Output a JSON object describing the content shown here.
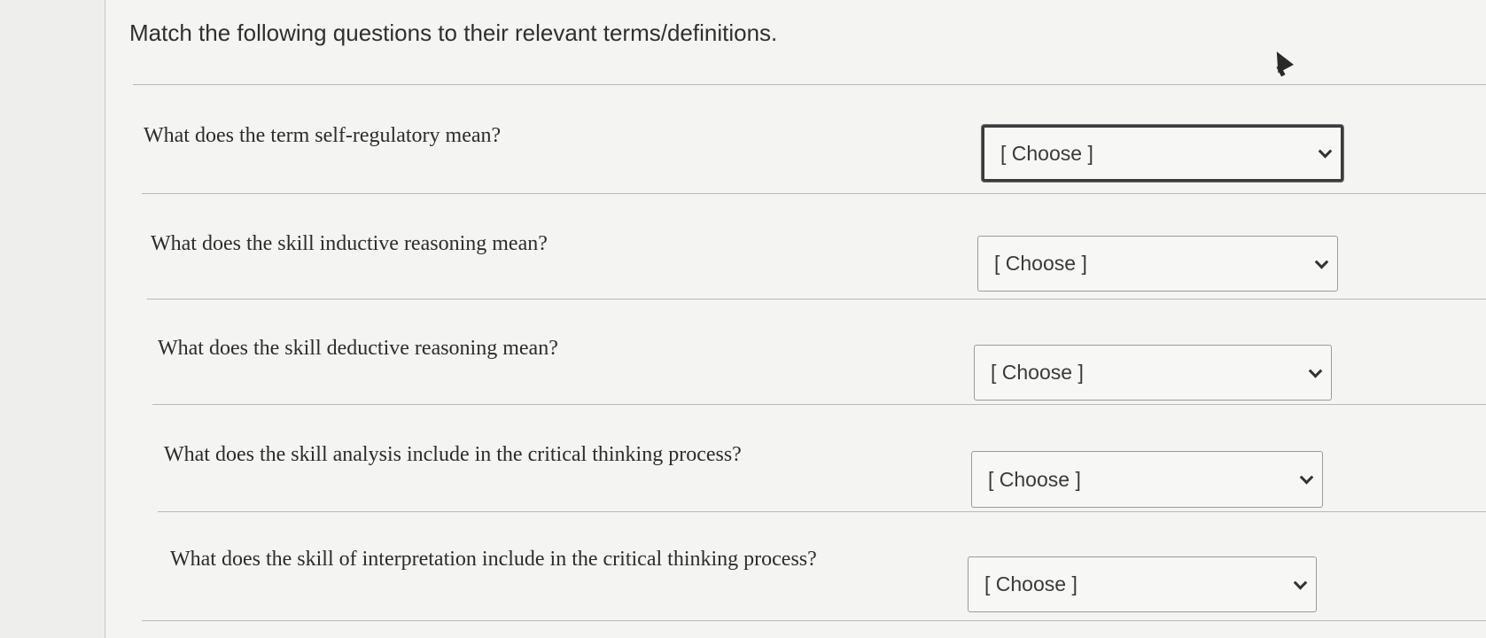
{
  "instructions": "Match the following questions to their relevant terms/definitions.",
  "questions": [
    {
      "text": "What does the term self-regulatory mean?",
      "selected": "[ Choose ]",
      "focused": true
    },
    {
      "text": "What does the skill inductive reasoning mean?",
      "selected": "[ Choose ]",
      "focused": false
    },
    {
      "text": "What does the skill deductive reasoning mean?",
      "selected": "[ Choose ]",
      "focused": false
    },
    {
      "text": "What does the skill analysis include in the critical thinking process?",
      "selected": "[ Choose ]",
      "focused": false
    },
    {
      "text": "What does the skill of interpretation include in the critical thinking process?",
      "selected": "[ Choose ]",
      "focused": false
    }
  ],
  "icons": {
    "dropdown": "chevron-down-icon",
    "cursor": "mouse-pointer-icon"
  },
  "colors": {
    "background": "#f4f5f2",
    "border": "#9a9c98",
    "focus_border": "#3a3b3c"
  }
}
